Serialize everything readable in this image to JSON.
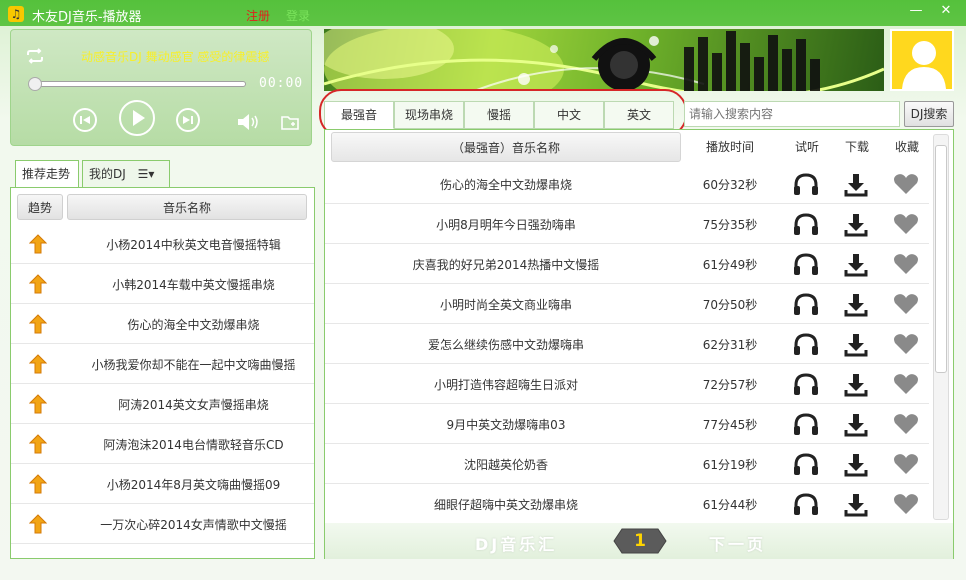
{
  "window": {
    "title": "木友DJ音乐-播放器",
    "register_label": "注册",
    "login_label": "登录",
    "minimize_label": "—",
    "close_label": "✕"
  },
  "player": {
    "marquee": "动感音乐DJ  舞动感官  感受的律震撼",
    "time": "00:00",
    "progress": 0
  },
  "left_tabs": [
    "推荐走势",
    "我的DJ"
  ],
  "left_list": {
    "headers": {
      "trend": "趋势",
      "name": "音乐名称"
    },
    "items": [
      "小杨2014中秋英文电音慢摇特辑",
      "小韩2014车载中英文慢摇串烧",
      "伤心的海全中文劲爆串烧",
      "小杨我爱你却不能在一起中文嗨曲慢摇",
      "阿涛2014英文女声慢摇串烧",
      "阿涛泡沫2014电台情歌轻音乐CD",
      "小杨2014年8月英文嗨曲慢摇09",
      "一万次心碎2014女声情歌中文慢摇"
    ]
  },
  "category_tabs": [
    "最强音",
    "现场串烧",
    "慢摇",
    "中文",
    "英文"
  ],
  "search": {
    "placeholder": "请输入搜索内容",
    "button_label": "DJ搜索"
  },
  "main_list": {
    "headers": {
      "name": "（最强音）音乐名称",
      "time": "播放时间",
      "listen": "试听",
      "download": "下载",
      "favorite": "收藏"
    },
    "rows": [
      {
        "name": "伤心的海全中文劲爆串烧",
        "time": "60分32秒"
      },
      {
        "name": "小明8月明年今日强劲嗨串",
        "time": "75分35秒"
      },
      {
        "name": "庆喜我的好兄弟2014热播中文慢摇",
        "time": "61分49秒"
      },
      {
        "name": "小明时尚全英文商业嗨串",
        "time": "70分50秒"
      },
      {
        "name": "爱怎么继续伤感中文劲爆嗨串",
        "time": "62分31秒"
      },
      {
        "name": "小明打造伟容超嗨生日派对",
        "time": "72分57秒"
      },
      {
        "name": "9月中英文劲爆嗨串03",
        "time": "77分45秒"
      },
      {
        "name": "沈阳越英伦奶香",
        "time": "61分19秒"
      },
      {
        "name": "细眼仔超嗨中英文劲爆串烧",
        "time": "61分44秒"
      }
    ]
  },
  "pagination": {
    "dj_hall": "DJ音乐汇",
    "page": "1",
    "next_label": "下一页"
  },
  "icons": {
    "app": "music-note-icon",
    "loop": "loop-icon",
    "prev": "previous-icon",
    "play": "play-icon",
    "next": "next-icon",
    "volume": "volume-icon",
    "folder": "folder-icon",
    "trend": "trend-arrow-icon",
    "listen": "headphones-icon",
    "download": "download-icon",
    "favorite": "heart-icon"
  },
  "colors": {
    "accent": "#55c13c",
    "marquee": "#f7ef2c",
    "register": "#e0221c",
    "page_num": "#ffd400",
    "highlight_oval": "#d62727"
  }
}
